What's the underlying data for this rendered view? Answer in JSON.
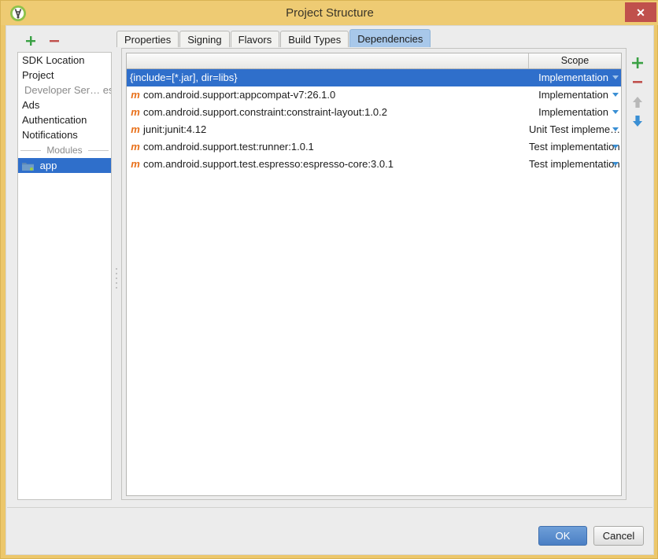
{
  "window": {
    "title": "Project Structure",
    "app_icon": "android-studio-icon",
    "close_label": "✕",
    "titlebar_color": "#eecb73"
  },
  "sidebar": {
    "toolbar": {
      "add_label": "+",
      "remove_label": "−"
    },
    "items": [
      {
        "label": "SDK Location",
        "type": "item",
        "selected": false
      },
      {
        "label": "Project",
        "type": "item",
        "selected": false
      },
      {
        "label": "Developer Ser… es",
        "type": "group",
        "selected": false
      },
      {
        "label": "Ads",
        "type": "item",
        "selected": false
      },
      {
        "label": "Authentication",
        "type": "item",
        "selected": false
      },
      {
        "label": "Notifications",
        "type": "item",
        "selected": false
      }
    ],
    "separator_label": "Modules",
    "modules": [
      {
        "label": "app",
        "icon": "module-folder-icon",
        "selected": true
      }
    ]
  },
  "tabs": [
    {
      "label": "Properties",
      "active": false
    },
    {
      "label": "Signing",
      "active": false
    },
    {
      "label": "Flavors",
      "active": false
    },
    {
      "label": "Build Types",
      "active": false
    },
    {
      "label": "Dependencies",
      "active": true
    }
  ],
  "table": {
    "headers": {
      "name": "",
      "scope": "Scope"
    },
    "rows": [
      {
        "name": "{include=[*.jar], dir=libs}",
        "icon": "",
        "scope": "Implementation",
        "selected": true,
        "caret": true
      },
      {
        "name": "com.android.support:appcompat-v7:26.1.0",
        "icon": "m",
        "scope": "Implementation",
        "selected": false,
        "caret": true
      },
      {
        "name": "com.android.support.constraint:constraint-layout:1.0.2",
        "icon": "m",
        "scope": "Implementation",
        "selected": false,
        "caret": true
      },
      {
        "name": "junit:junit:4.12",
        "icon": "m",
        "scope": "Unit Test impleme…",
        "selected": false,
        "caret": true
      },
      {
        "name": "com.android.support.test:runner:1.0.1",
        "icon": "m",
        "scope": "Test implementation",
        "selected": false,
        "caret": true
      },
      {
        "name": "com.android.support.test.espresso:espresso-core:3.0.1",
        "icon": "m",
        "scope": "Test implementation",
        "selected": false,
        "caret": true
      }
    ]
  },
  "right_toolbar": {
    "add_label": "+",
    "remove_label": "−",
    "move_up": "move-up-arrow",
    "move_down": "move-down-arrow"
  },
  "footer": {
    "ok_label": "OK",
    "cancel_label": "Cancel"
  },
  "colors": {
    "accent_blue": "#2f6fcb",
    "title_gold": "#eecb73",
    "maven_orange": "#e8701a",
    "add_green": "#3aa144",
    "remove_red": "#c0504c",
    "close_red": "#c0504c"
  }
}
